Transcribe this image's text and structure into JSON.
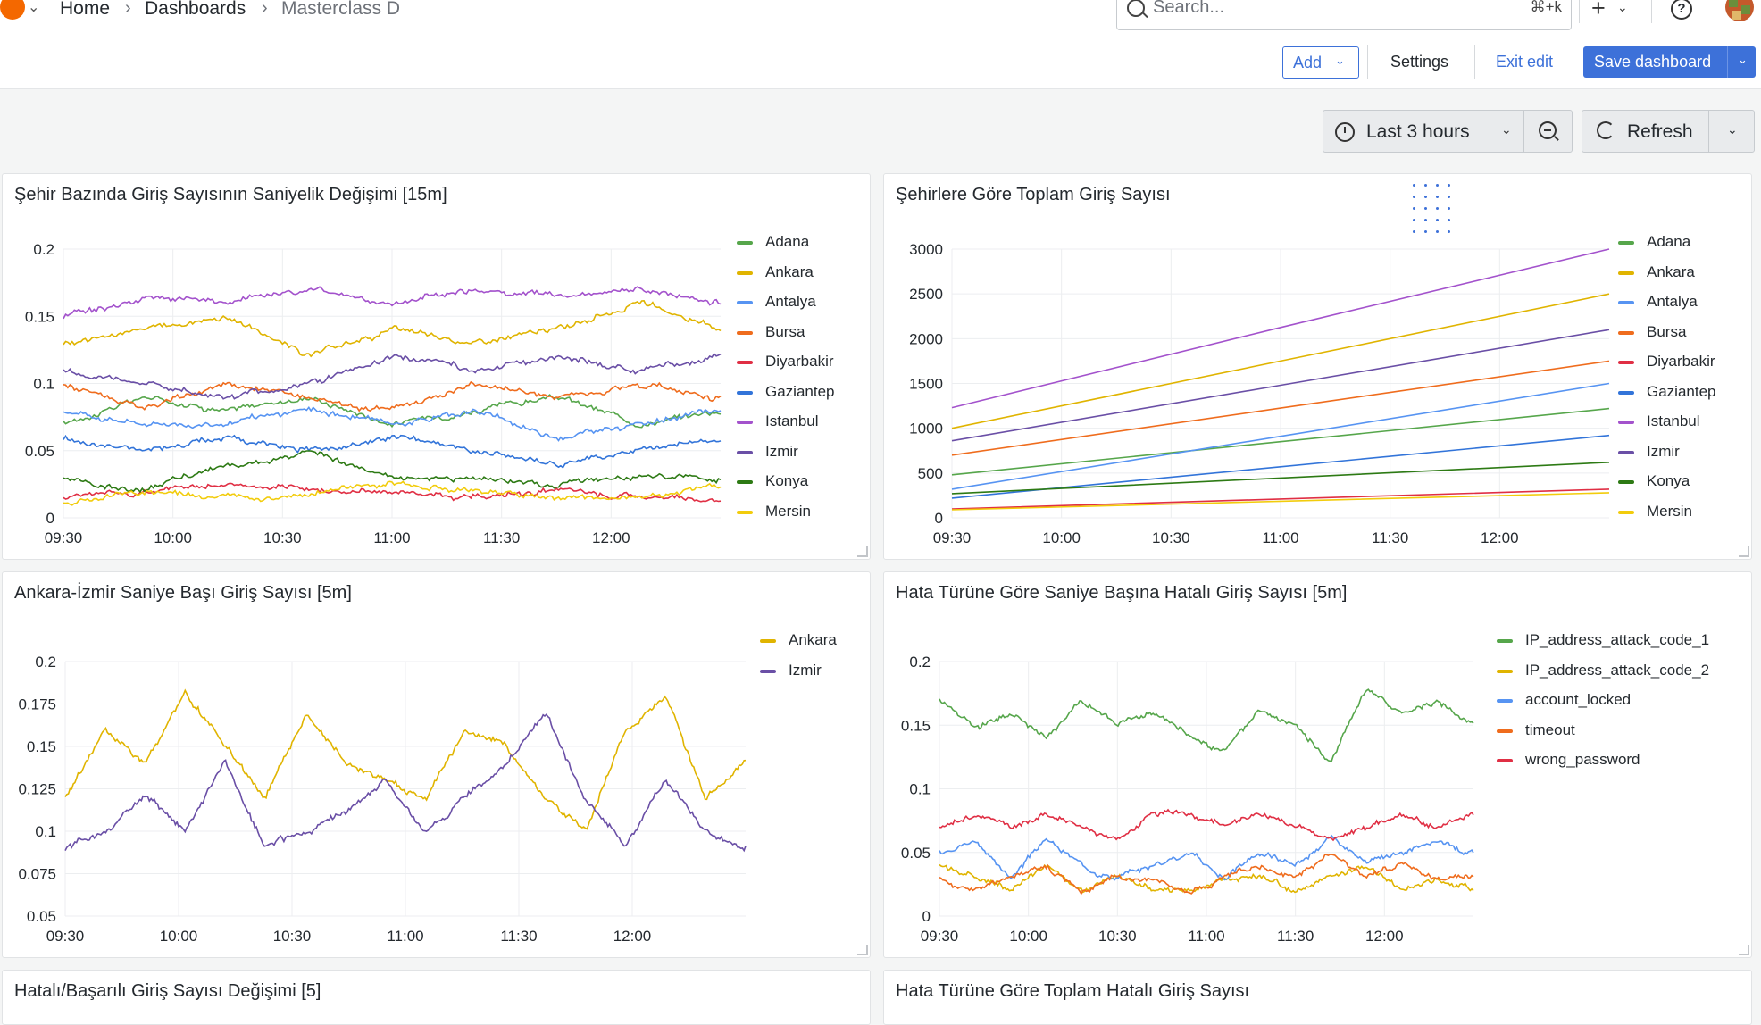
{
  "breadcrumb": {
    "items": [
      "Home",
      "Dashboards",
      "Masterclass D"
    ]
  },
  "search": {
    "placeholder": "Search...",
    "shortcut": "⌘+k"
  },
  "toolbar": {
    "add_label": "Add",
    "settings_label": "Settings",
    "exit_edit_label": "Exit edit",
    "save_label": "Save dashboard"
  },
  "time_picker": {
    "label": "Last 3 hours"
  },
  "refresh": {
    "label": "Refresh"
  },
  "icons": [
    "grafana-logo-icon",
    "chevron-down-icon",
    "search-icon",
    "plus-icon",
    "help-icon",
    "clock-icon",
    "zoom-out-icon",
    "refresh-icon"
  ],
  "colors": {
    "accent": "#3d71d9",
    "Adana": "#56a64b",
    "Ankara": "#e0b400",
    "Antalya": "#5794f2",
    "Bursa": "#ef6c1d",
    "Diyarbakir": "#e02f44",
    "Gaziantep": "#3274d9",
    "Istanbul": "#a352cc",
    "Izmir": "#6a4fa6",
    "Konya": "#2d7a14",
    "Mersin": "#f2cc0c",
    "IP_address_attack_code_1": "#56a64b",
    "IP_address_attack_code_2": "#e0b400",
    "account_locked": "#5794f2",
    "timeout": "#ef6c1d",
    "wrong_password": "#e02f44"
  },
  "panels": [
    {
      "title": "Şehir Bazında Giriş Sayısının Saniyelik Değişimi [15m]",
      "chart_data": {
        "type": "line",
        "x_ticks": [
          "09:30",
          "10:00",
          "10:30",
          "11:00",
          "11:30",
          "12:00"
        ],
        "x_range": [
          "09:30",
          "12:30"
        ],
        "y_ticks": [
          "0",
          "0.05",
          "0.1",
          "0.15",
          "0.2"
        ],
        "ylim": [
          0,
          0.2
        ],
        "series": [
          {
            "name": "Adana",
            "values": [
              0.07,
              0.09,
              0.08,
              0.09,
              0.07,
              0.08,
              0.09,
              0.07,
              0.08
            ]
          },
          {
            "name": "Ankara",
            "values": [
              0.13,
              0.14,
              0.15,
              0.12,
              0.14,
              0.13,
              0.14,
              0.16,
              0.14
            ]
          },
          {
            "name": "Antalya",
            "values": [
              0.08,
              0.07,
              0.07,
              0.08,
              0.07,
              0.08,
              0.06,
              0.07,
              0.08
            ]
          },
          {
            "name": "Bursa",
            "values": [
              0.1,
              0.08,
              0.1,
              0.09,
              0.08,
              0.1,
              0.09,
              0.1,
              0.09
            ]
          },
          {
            "name": "Diyarbakir",
            "values": [
              0.015,
              0.02,
              0.025,
              0.02,
              0.02,
              0.015,
              0.02,
              0.015,
              0.012
            ]
          },
          {
            "name": "Gaziantep",
            "values": [
              0.06,
              0.05,
              0.06,
              0.05,
              0.06,
              0.05,
              0.04,
              0.05,
              0.06
            ]
          },
          {
            "name": "Istanbul",
            "values": [
              0.15,
              0.165,
              0.16,
              0.17,
              0.16,
              0.17,
              0.165,
              0.17,
              0.16
            ]
          },
          {
            "name": "Izmir",
            "values": [
              0.11,
              0.1,
              0.09,
              0.1,
              0.12,
              0.11,
              0.12,
              0.11,
              0.12
            ]
          },
          {
            "name": "Konya",
            "values": [
              0.03,
              0.02,
              0.04,
              0.05,
              0.03,
              0.03,
              0.025,
              0.03,
              0.03
            ]
          },
          {
            "name": "Mersin",
            "values": [
              0.01,
              0.02,
              0.015,
              0.02,
              0.025,
              0.02,
              0.015,
              0.015,
              0.025
            ]
          }
        ]
      }
    },
    {
      "title": "Şehirlere Göre Toplam Giriş Sayısı",
      "chart_data": {
        "type": "line",
        "x_ticks": [
          "09:30",
          "10:00",
          "10:30",
          "11:00",
          "11:30",
          "12:00"
        ],
        "x_range": [
          "09:30",
          "12:30"
        ],
        "y_ticks": [
          "0",
          "500",
          "1000",
          "1500",
          "2000",
          "2500",
          "3000"
        ],
        "ylim": [
          0,
          3000
        ],
        "series": [
          {
            "name": "Adana",
            "values": [
              480,
              1220
            ]
          },
          {
            "name": "Ankara",
            "values": [
              1000,
              2500
            ]
          },
          {
            "name": "Antalya",
            "values": [
              320,
              1500
            ]
          },
          {
            "name": "Bursa",
            "values": [
              700,
              1750
            ]
          },
          {
            "name": "Diyarbakir",
            "values": [
              100,
              320
            ]
          },
          {
            "name": "Gaziantep",
            "values": [
              220,
              920
            ]
          },
          {
            "name": "Istanbul",
            "values": [
              1230,
              3020
            ]
          },
          {
            "name": "Izmir",
            "values": [
              860,
              2100
            ]
          },
          {
            "name": "Konya",
            "values": [
              270,
              620
            ]
          },
          {
            "name": "Mersin",
            "values": [
              90,
              280
            ]
          }
        ]
      }
    },
    {
      "title": "Ankara-İzmir Saniye Başı Giriş Sayısı [5m]",
      "chart_data": {
        "type": "line",
        "x_ticks": [
          "09:30",
          "10:00",
          "10:30",
          "11:00",
          "11:30",
          "12:00"
        ],
        "x_range": [
          "09:30",
          "12:30"
        ],
        "y_ticks": [
          "0.05",
          "0.075",
          "0.1",
          "0.125",
          "0.15",
          "0.175",
          "0.2"
        ],
        "ylim": [
          0.05,
          0.2
        ],
        "series": [
          {
            "name": "Ankara",
            "values": [
              0.12,
              0.16,
              0.14,
              0.18,
              0.15,
              0.12,
              0.17,
              0.14,
              0.13,
              0.12,
              0.16,
              0.15,
              0.12,
              0.1,
              0.16,
              0.18,
              0.12,
              0.14
            ]
          },
          {
            "name": "Izmir",
            "values": [
              0.09,
              0.1,
              0.12,
              0.1,
              0.14,
              0.09,
              0.1,
              0.11,
              0.13,
              0.1,
              0.12,
              0.14,
              0.17,
              0.12,
              0.09,
              0.13,
              0.1,
              0.09
            ]
          }
        ]
      }
    },
    {
      "title": "Hata Türüne Göre Saniye Başına Hatalı Giriş Sayısı [5m]",
      "chart_data": {
        "type": "line",
        "x_ticks": [
          "09:30",
          "10:00",
          "10:30",
          "11:00",
          "11:30",
          "12:00"
        ],
        "x_range": [
          "09:30",
          "12:30"
        ],
        "y_ticks": [
          "0",
          "0.05",
          "0.1",
          "0.15",
          "0.2"
        ],
        "ylim": [
          0,
          0.2
        ],
        "series": [
          {
            "name": "IP_address_attack_code_1",
            "values": [
              0.17,
              0.15,
              0.16,
              0.14,
              0.17,
              0.15,
              0.16,
              0.14,
              0.13,
              0.16,
              0.15,
              0.12,
              0.18,
              0.16,
              0.17,
              0.15
            ]
          },
          {
            "name": "IP_address_attack_code_2",
            "values": [
              0.04,
              0.03,
              0.02,
              0.04,
              0.02,
              0.03,
              0.02,
              0.02,
              0.03,
              0.03,
              0.02,
              0.03,
              0.04,
              0.02,
              0.03,
              0.02
            ]
          },
          {
            "name": "account_locked",
            "values": [
              0.05,
              0.06,
              0.03,
              0.06,
              0.04,
              0.03,
              0.04,
              0.05,
              0.03,
              0.05,
              0.04,
              0.06,
              0.04,
              0.05,
              0.06,
              0.05
            ]
          },
          {
            "name": "timeout",
            "values": [
              0.03,
              0.02,
              0.03,
              0.04,
              0.02,
              0.03,
              0.03,
              0.02,
              0.03,
              0.04,
              0.03,
              0.05,
              0.03,
              0.04,
              0.03,
              0.03
            ]
          },
          {
            "name": "wrong_password",
            "values": [
              0.07,
              0.08,
              0.07,
              0.08,
              0.07,
              0.06,
              0.08,
              0.08,
              0.07,
              0.08,
              0.07,
              0.06,
              0.07,
              0.08,
              0.07,
              0.08
            ]
          }
        ]
      }
    },
    {
      "title": "Hatalı/Başarılı Giriş Sayısı Değişimi [5]"
    },
    {
      "title": "Hata Türüne Göre Toplam Hatalı Giriş Sayısı"
    }
  ]
}
